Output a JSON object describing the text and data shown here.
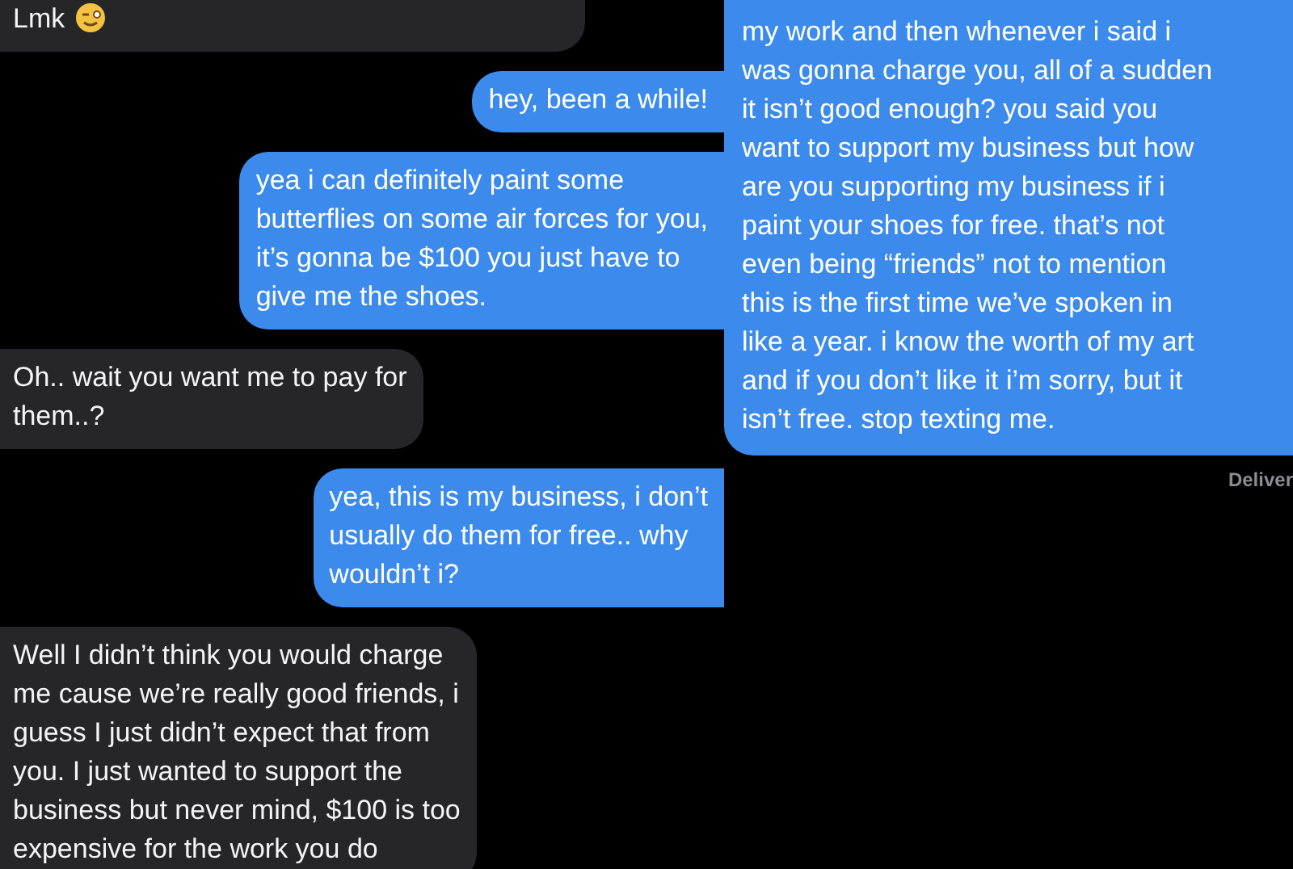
{
  "left_chat": {
    "messages": [
      {
        "kind": "received",
        "text": "Lmk",
        "has_emoji": true
      },
      {
        "kind": "sent",
        "text": "hey, been a while!"
      },
      {
        "kind": "sent",
        "text": "yea i can definitely paint some\nbutterflies on some air forces for you,\nit’s gonna be $100 you just have to\ngive me the shoes."
      },
      {
        "kind": "received",
        "text": "Oh.. wait you want me to pay for\nthem..?"
      },
      {
        "kind": "sent",
        "text": "yea, this is my business, i don’t\nusually do them for free.. why\nwouldn’t i?"
      },
      {
        "kind": "received",
        "text": "Well I didn’t think you would charge\nme cause we’re really good friends, i\nguess I just didn’t expect that from\nyou. I just wanted to support the\nbusiness but never mind, $100 is too\nexpensive for the work you do"
      }
    ]
  },
  "right_chat": {
    "messages": [
      {
        "kind": "sent",
        "text": "my work and then whenever i said i\nwas gonna charge you, all of a sudden\nit isn’t good enough? you said you\nwant to support my business but how\nare you supporting my business if i\npaint your shoes for free. that’s not\neven being “friends” not to mention\nthis is the first time we’ve spoken in\nlike a year. i know the worth of my art\nand if you don’t like it i’m sorry, but it\nisn’t free. stop texting me."
      }
    ],
    "status": "Deliver"
  }
}
